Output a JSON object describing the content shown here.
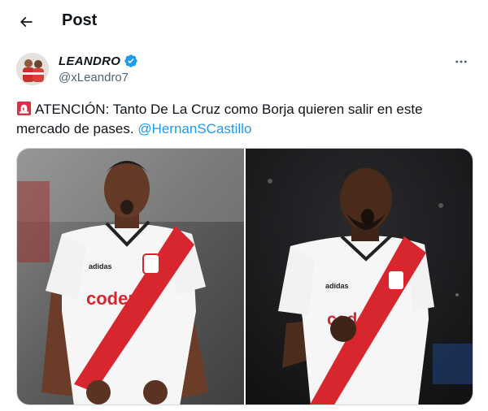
{
  "header": {
    "title": "Post"
  },
  "author": {
    "display_name": "LEANDRO",
    "handle": "@xLeandro7",
    "verified": true
  },
  "tweet": {
    "emoji": "siren",
    "text": "ATENCIÓN: Tanto De La Cruz como Borja quieren salir en este mercado de pases. ",
    "mention": "@HernanSCastillo"
  },
  "media": {
    "photos": [
      {
        "sponsor": "codere",
        "brand": "adidas"
      },
      {
        "sponsor": "codere",
        "brand": "adidas"
      }
    ]
  },
  "colors": {
    "accent": "#1d9bf0",
    "text": "#0f1419",
    "secondary_text": "#536471",
    "jersey_band": "#d7262e"
  }
}
